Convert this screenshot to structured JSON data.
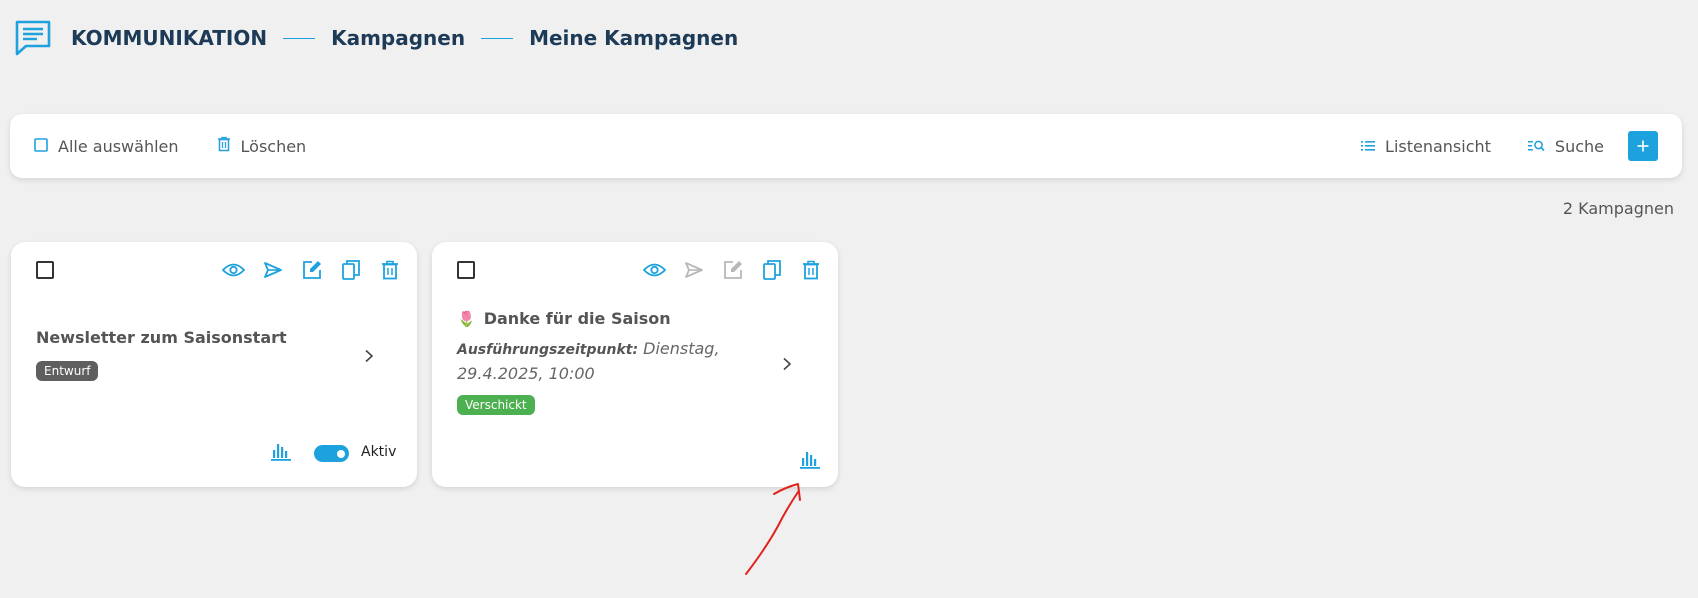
{
  "breadcrumb": [
    "KOMMUNIKATION",
    "Kampagnen",
    "Meine Kampagnen"
  ],
  "toolbar": {
    "select_all": "Alle auswählen",
    "delete": "Löschen",
    "list_view": "Listenansicht",
    "search": "Suche",
    "add": "+"
  },
  "count_label": "2 Kampagnen",
  "cards": [
    {
      "title": "Newsletter zum Saisonstart",
      "status": "Entwurf",
      "toggle_label": "Aktiv",
      "toggle_on": true
    },
    {
      "emoji": "🌷",
      "title": "Danke für die Saison",
      "exec_label": "Ausführungszeitpunkt:",
      "exec_value": "Dienstag, 29.4.2025, 10:00",
      "status": "Verschickt"
    }
  ],
  "colors": {
    "accent": "#1ea2de",
    "draft_badge": "#5f5f5f",
    "sent_badge": "#4caf50",
    "title_dark": "#1d3a57",
    "annotation_red": "#e0231b"
  }
}
